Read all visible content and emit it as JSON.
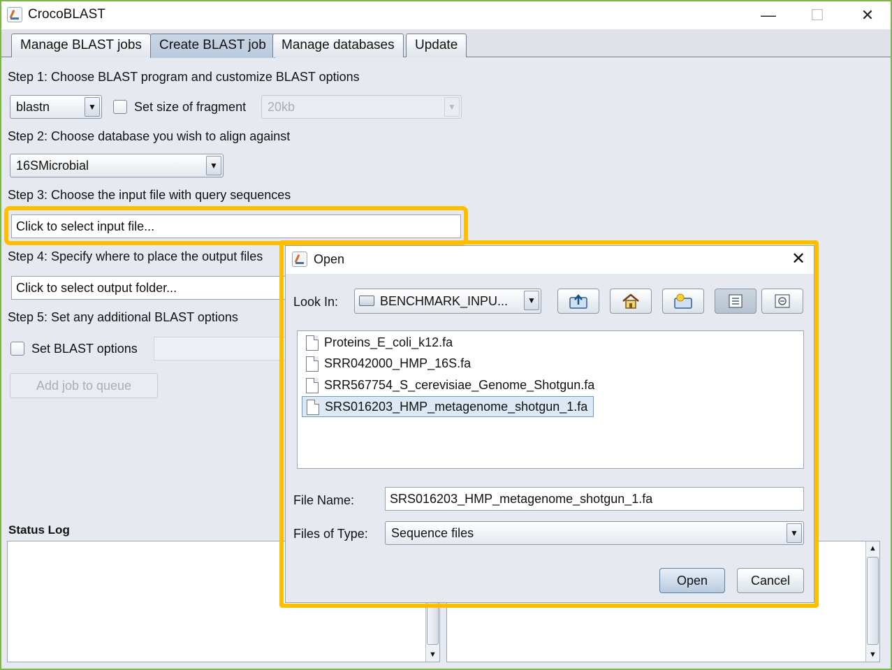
{
  "window": {
    "title": "CrocoBLAST",
    "controls": {
      "minimize": "—",
      "maximize": "☐",
      "close": "✕"
    }
  },
  "tabs": [
    {
      "label": "Manage BLAST jobs",
      "active": false
    },
    {
      "label": "Create BLAST job",
      "active": true
    },
    {
      "label": "Manage databases",
      "active": false
    },
    {
      "label": "Update",
      "active": false
    }
  ],
  "step1": {
    "label": "Step 1: Choose BLAST program and customize BLAST options",
    "program": "blastn",
    "fragment_checkbox_label": "Set size of fragment",
    "fragment_size": "20kb"
  },
  "step2": {
    "label": "Step 2: Choose database you wish to align against",
    "database": "16SMicrobial"
  },
  "step3": {
    "label": "Step 3: Choose the input file with query sequences",
    "input_placeholder": "Click to select input file..."
  },
  "step4": {
    "label": "Step 4: Specify where to place the output files",
    "output_placeholder": "Click to select output folder..."
  },
  "step5": {
    "label": "Step 5: Set any additional BLAST options",
    "options_checkbox_label": "Set BLAST options"
  },
  "add_job_label": "Add job to queue",
  "status_log_label": "Status Log",
  "scroll": {
    "up": "▲",
    "down": "▼"
  },
  "dialog": {
    "title": "Open",
    "close": "✕",
    "look_in_label": "Look In:",
    "look_in_value": "BENCHMARK_INPU...",
    "toolbar_icons": [
      "up-folder-icon",
      "home-icon",
      "new-folder-icon",
      "list-view-icon",
      "details-view-icon"
    ],
    "files": [
      "Proteins_E_coli_k12.fa",
      "SRR042000_HMP_16S.fa",
      "SRR567754_S_cerevisiae_Genome_Shotgun.fa",
      "SRS016203_HMP_metagenome_shotgun_1.fa"
    ],
    "selected_file_index": 3,
    "file_name_label": "File Name:",
    "file_name_value": "SRS016203_HMP_metagenome_shotgun_1.fa",
    "files_of_type_label": "Files of Type:",
    "files_of_type_value": "Sequence files",
    "open_button": "Open",
    "cancel_button": "Cancel"
  },
  "colors": {
    "window_border": "#7ab648",
    "highlight": "#ffbf00",
    "background": "#e6e9ef",
    "selection": "#dde8f5"
  }
}
